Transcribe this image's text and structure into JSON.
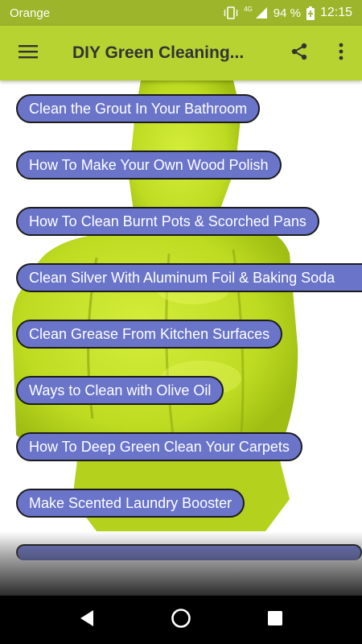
{
  "status_bar": {
    "carrier": "Orange",
    "network": "4G",
    "battery": "94 %",
    "time": "12:15"
  },
  "app_bar": {
    "title": "DIY Green Cleaning...",
    "background": "#b6d332"
  },
  "items": [
    {
      "label": "Clean the Grout In Your Bathroom"
    },
    {
      "label": "How To Make Your Own Wood Polish"
    },
    {
      "label": "How To Clean Burnt Pots & Scorched Pans"
    },
    {
      "label": "Clean Silver With Aluminum Foil & Baking Soda"
    },
    {
      "label": "Clean Grease From Kitchen Surfaces"
    },
    {
      "label": "Ways to Clean with Olive Oil"
    },
    {
      "label": "How To Deep Green Clean Your Carpets"
    },
    {
      "label": "Make Scented Laundry Booster"
    }
  ],
  "colors": {
    "status_bar": "#9cb52a",
    "button_fill": "#6a74c9",
    "glove": "#c4e226"
  },
  "nav": {
    "back": "back-icon",
    "home": "home-icon",
    "recents": "recents-icon"
  }
}
